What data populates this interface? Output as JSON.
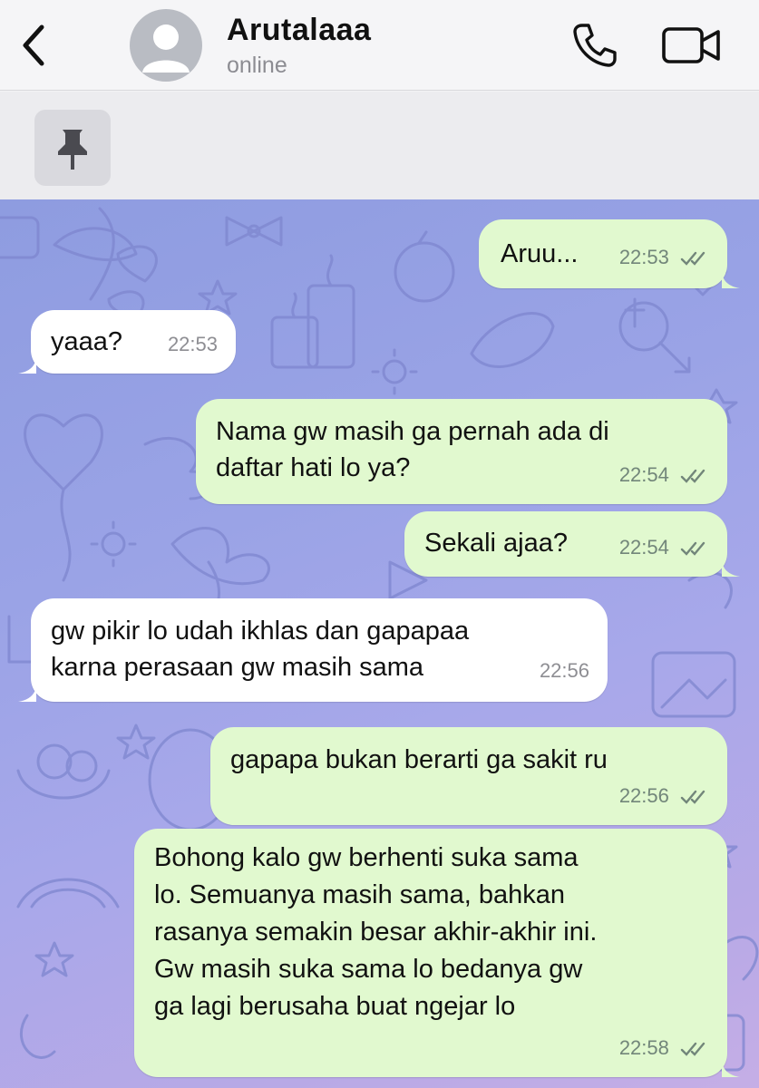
{
  "header": {
    "contact_name": "Arutalaaa",
    "status": "online",
    "icons": [
      "chevron-left-icon",
      "user-avatar-icon",
      "phone-icon",
      "video-camera-icon",
      "pin-icon"
    ]
  },
  "colors": {
    "outgoing_bubble": "#e1f9cf",
    "incoming_bubble": "#ffffff",
    "timestamp_out": "#72867a",
    "timestamp_in": "#8e8e93",
    "chat_background": "#9aa3e6"
  },
  "messages": [
    {
      "direction": "outgoing",
      "lines": [
        "Aruu..."
      ],
      "time": "22:53",
      "status": "read"
    },
    {
      "direction": "incoming",
      "lines": [
        "yaaa?"
      ],
      "time": "22:53"
    },
    {
      "direction": "outgoing",
      "lines": [
        "Nama gw masih ga pernah ada di",
        "daftar hati lo ya?"
      ],
      "time": "22:54",
      "status": "read"
    },
    {
      "direction": "outgoing",
      "lines": [
        "Sekali ajaa?"
      ],
      "time": "22:54",
      "status": "read"
    },
    {
      "direction": "incoming",
      "lines": [
        "gw pikir lo udah ikhlas dan gapapaa",
        "karna perasaan gw masih sama"
      ],
      "time": "22:56"
    },
    {
      "direction": "outgoing",
      "lines": [
        "gapapa bukan berarti ga sakit ru"
      ],
      "time": "22:56",
      "status": "read"
    },
    {
      "direction": "outgoing",
      "lines": [
        "Bohong kalo gw berhenti suka sama",
        "lo. Semuanya masih sama, bahkan",
        "rasanya semakin besar akhir-akhir ini.",
        "Gw masih suka sama lo bedanya gw",
        "ga lagi berusaha buat ngejar lo"
      ],
      "time": "22:58",
      "status": "read"
    }
  ]
}
